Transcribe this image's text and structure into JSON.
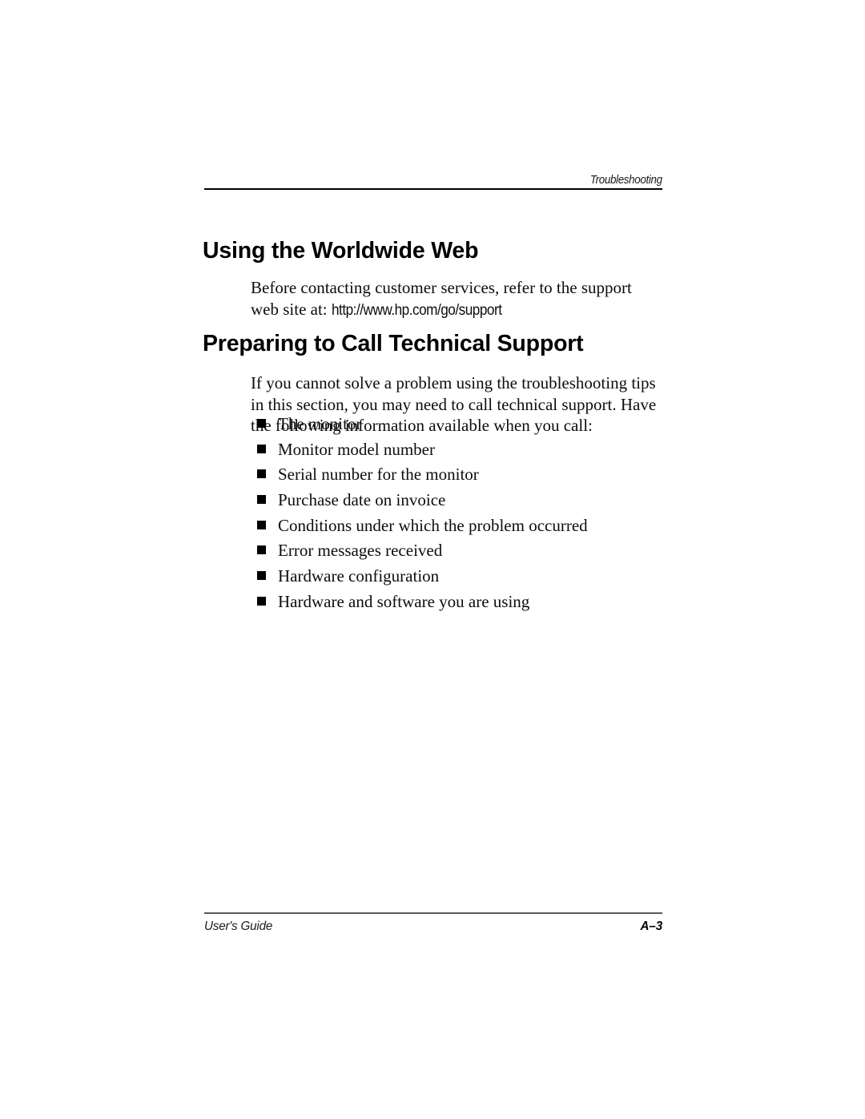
{
  "header": {
    "chapter_title": "Troubleshooting"
  },
  "sections": [
    {
      "heading": "Using the Worldwide Web",
      "paragraph_lead": "Before contacting customer services, refer to the support web site at: ",
      "url": "http://www.hp.com/go/support"
    },
    {
      "heading": "Preparing to Call Technical Support",
      "paragraph": "If you cannot solve a problem using the troubleshooting tips in this section, you may need to call technical support. Have the following information available when you call:"
    }
  ],
  "checklist": {
    "items": [
      "The monitor",
      "Monitor model number",
      "Serial number for the monitor",
      "Purchase date on invoice",
      "Conditions under which the problem occurred",
      "Error messages received",
      "Hardware configuration",
      "Hardware and software you are using"
    ]
  },
  "footer": {
    "document_title": "User's Guide",
    "page_number": "A–3"
  }
}
